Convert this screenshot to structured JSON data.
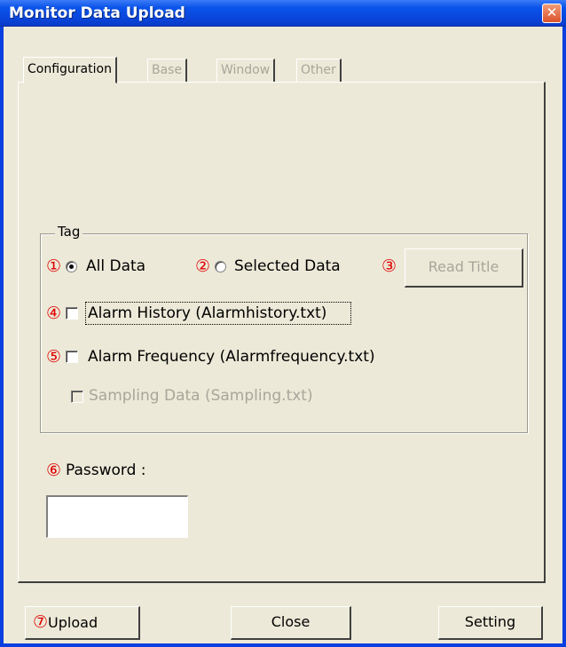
{
  "window": {
    "title": "Monitor Data Upload",
    "close_glyph": "✕"
  },
  "tabs": [
    {
      "label": "Configuration",
      "state": "active"
    },
    {
      "label": "Base",
      "state": "disabled"
    },
    {
      "label": "Window",
      "state": "disabled"
    },
    {
      "label": "Other",
      "state": "disabled"
    }
  ],
  "tag_group": {
    "label": "Tag",
    "all_data": {
      "marker": "①",
      "label": "All Data",
      "checked": true
    },
    "selected_data": {
      "marker": "②",
      "label": "Selected Data",
      "checked": false
    },
    "read_title": {
      "marker": "③",
      "label": "Read Title",
      "enabled": false
    },
    "alarm_history": {
      "marker": "④",
      "label": "Alarm History (Alarmhistory.txt)",
      "checked": false
    },
    "alarm_frequency": {
      "marker": "⑤",
      "label": "Alarm Frequency (Alarmfrequency.txt)",
      "checked": false
    },
    "sampling_data": {
      "label": "Sampling Data (Sampling.txt)",
      "checked": false,
      "enabled": false
    }
  },
  "password": {
    "marker": "⑥",
    "label": "Password :",
    "value": ""
  },
  "footer": {
    "upload_marker": "⑦",
    "upload_label": "Upload",
    "close_label": "Close",
    "setting_label": "Setting"
  },
  "colors": {
    "titlebar": "#0a46dc",
    "client_bg": "#ece9d8",
    "marker_red": "#e00000",
    "disabled_text": "#a8a69a"
  }
}
